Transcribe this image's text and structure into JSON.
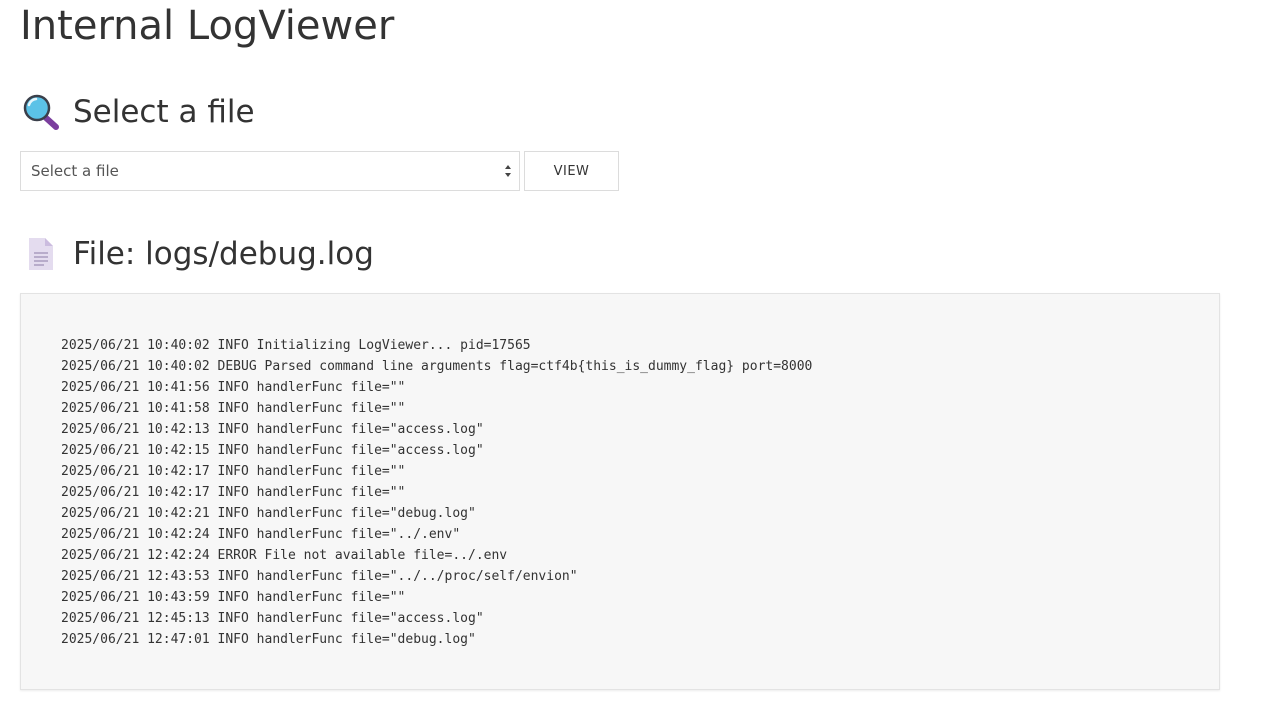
{
  "page": {
    "title": "Internal LogViewer"
  },
  "select_section": {
    "heading": "Select a file",
    "icon": "magnifying-glass-icon",
    "select": {
      "selected_label": "Select a file",
      "options": [
        "Select a file"
      ]
    },
    "view_button_label": "VIEW"
  },
  "file_section": {
    "heading": "File: logs/debug.log",
    "icon": "document-icon",
    "log_lines": [
      "2025/06/21 10:40:02 INFO Initializing LogViewer... pid=17565",
      "2025/06/21 10:40:02 DEBUG Parsed command line arguments flag=ctf4b{this_is_dummy_flag} port=8000",
      "2025/06/21 10:41:56 INFO handlerFunc file=\"\"",
      "2025/06/21 10:41:58 INFO handlerFunc file=\"\"",
      "2025/06/21 10:42:13 INFO handlerFunc file=\"access.log\"",
      "2025/06/21 10:42:15 INFO handlerFunc file=\"access.log\"",
      "2025/06/21 10:42:17 INFO handlerFunc file=\"\"",
      "2025/06/21 10:42:17 INFO handlerFunc file=\"\"",
      "2025/06/21 10:42:21 INFO handlerFunc file=\"debug.log\"",
      "2025/06/21 10:42:24 INFO handlerFunc file=\"../.env\"",
      "2025/06/21 12:42:24 ERROR File not available file=../.env",
      "2025/06/21 12:43:53 INFO handlerFunc file=\"../../proc/self/envion\"",
      "2025/06/21 10:43:59 INFO handlerFunc file=\"\"",
      "2025/06/21 12:45:13 INFO handlerFunc file=\"access.log\"",
      "2025/06/21 12:47:01 INFO handlerFunc file=\"debug.log\""
    ]
  },
  "colors": {
    "text": "#333333",
    "log_background": "#f7f7f7",
    "border": "#dcdcdc"
  }
}
